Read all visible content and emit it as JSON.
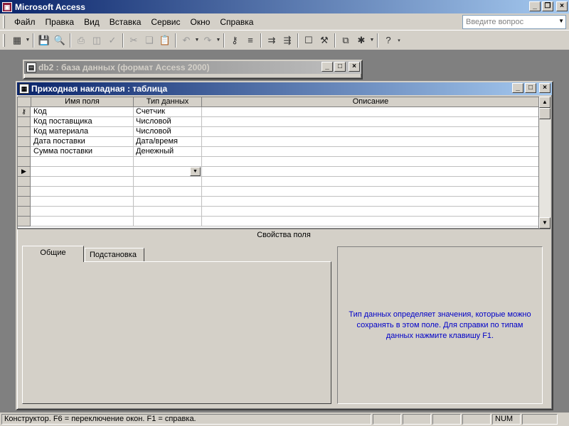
{
  "app": {
    "title": "Microsoft Access"
  },
  "menu": [
    "Файл",
    "Правка",
    "Вид",
    "Вставка",
    "Сервис",
    "Окно",
    "Справка"
  ],
  "ask": {
    "placeholder": "Введите вопрос"
  },
  "toolbar": {
    "icons": [
      "view-icon",
      "save-icon",
      "search-file-icon",
      "print-icon",
      "print-preview-icon",
      "spelling-icon",
      "cut-icon",
      "copy-icon",
      "paste-icon",
      "undo-icon",
      "redo-icon",
      "primary-key-icon",
      "indexes-icon",
      "insert-rows-icon",
      "delete-rows-icon",
      "properties-icon",
      "build-icon",
      "database-window-icon",
      "new-object-icon",
      "help-icon"
    ]
  },
  "db_window": {
    "title": "db2 : база данных (формат Access 2000)"
  },
  "table_window": {
    "title": "Приходная накладная : таблица"
  },
  "grid": {
    "headers": {
      "field_name": "Имя поля",
      "data_type": "Тип данных",
      "description": "Описание"
    },
    "rows": [
      {
        "field_name": "Код",
        "data_type": "Счетчик",
        "description": "",
        "key": true
      },
      {
        "field_name": "Код поставщика",
        "data_type": "Числовой",
        "description": ""
      },
      {
        "field_name": "Код материала",
        "data_type": "Числовой",
        "description": ""
      },
      {
        "field_name": "Дата поставки",
        "data_type": "Дата/время",
        "description": ""
      },
      {
        "field_name": "Сумма поставки",
        "data_type": "Денежный",
        "description": ""
      }
    ]
  },
  "field_properties": {
    "title": "Свойства поля",
    "tabs": [
      "Общие",
      "Подстановка"
    ],
    "active_tab": "Общие",
    "hint": "Тип данных определяет значения, которые можно сохранять в этом поле.  Для справки по типам данных нажмите клавишу F1."
  },
  "status": {
    "text": "Конструктор.  F6 = переключение окон.  F1 = справка.",
    "num": "NUM"
  },
  "colors": {
    "title_active": "#0a246a",
    "face": "#d4d0c8",
    "hint_text": "#0000c8"
  }
}
